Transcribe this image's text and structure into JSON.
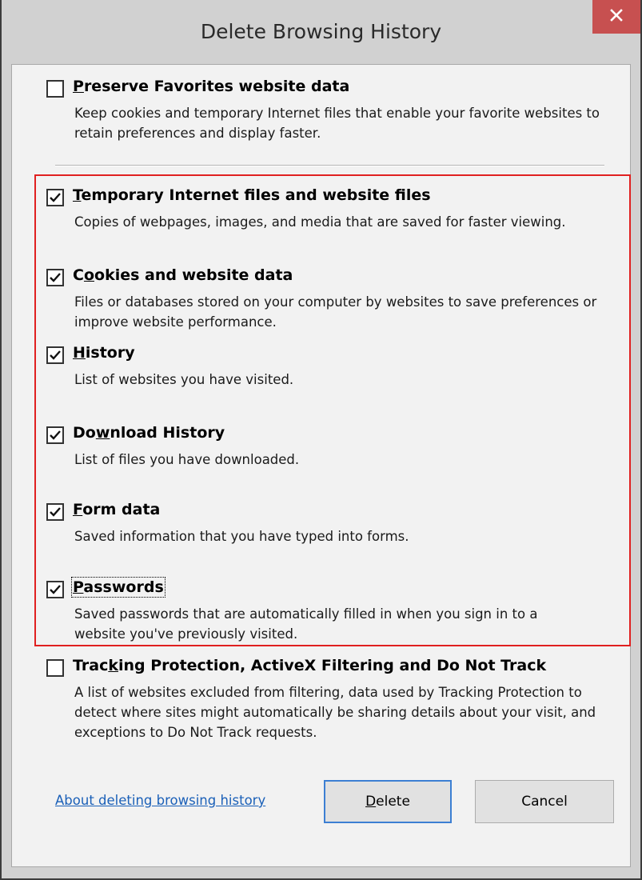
{
  "dialog": {
    "title": "Delete Browsing History",
    "close_glyph": "✕"
  },
  "options": [
    {
      "key": "preserve_favorites",
      "accel": "P",
      "label_rest": "reserve Favorites website data",
      "checked": false,
      "description": "Keep cookies and temporary Internet files that enable your favorite websites to retain preferences and display faster."
    },
    {
      "key": "temp_files",
      "accel": "T",
      "label_rest": "emporary Internet files and website files",
      "checked": true,
      "description": "Copies of webpages, images, and media that are saved for faster viewing."
    },
    {
      "key": "cookies",
      "accel_pre": "C",
      "accel": "o",
      "label_rest": "okies and website data",
      "checked": true,
      "description": "Files or databases stored on your computer by websites to save preferences or improve website performance."
    },
    {
      "key": "history",
      "accel": "H",
      "label_rest": "istory",
      "checked": true,
      "description": "List of websites you have visited."
    },
    {
      "key": "download_history",
      "accel_pre": "Do",
      "accel": "w",
      "label_rest": "nload History",
      "checked": true,
      "description": "List of files you have downloaded."
    },
    {
      "key": "form_data",
      "accel": "F",
      "label_rest": "orm data",
      "checked": true,
      "description": "Saved information that you have typed into forms."
    },
    {
      "key": "passwords",
      "accel": "P",
      "label_rest": "asswords",
      "checked": true,
      "focused": true,
      "description": "Saved passwords that are automatically filled in when you sign in to a website you've previously visited."
    },
    {
      "key": "tracking_protection",
      "accel_pre": "Trac",
      "accel": "k",
      "label_rest": "ing Protection, ActiveX Filtering and Do Not Track",
      "checked": false,
      "description": "A list of websites excluded from filtering, data used by Tracking Protection to detect where sites might automatically be sharing details about your visit, and exceptions to Do Not Track requests."
    }
  ],
  "footer": {
    "link": "About deleting browsing history",
    "delete_accel": "D",
    "delete_rest": "elete",
    "cancel": "Cancel"
  },
  "colors": {
    "highlight_border": "#e02020",
    "close_button": "#c75050",
    "link": "#1b60b8",
    "primary_button_border": "#3c7fd3"
  }
}
